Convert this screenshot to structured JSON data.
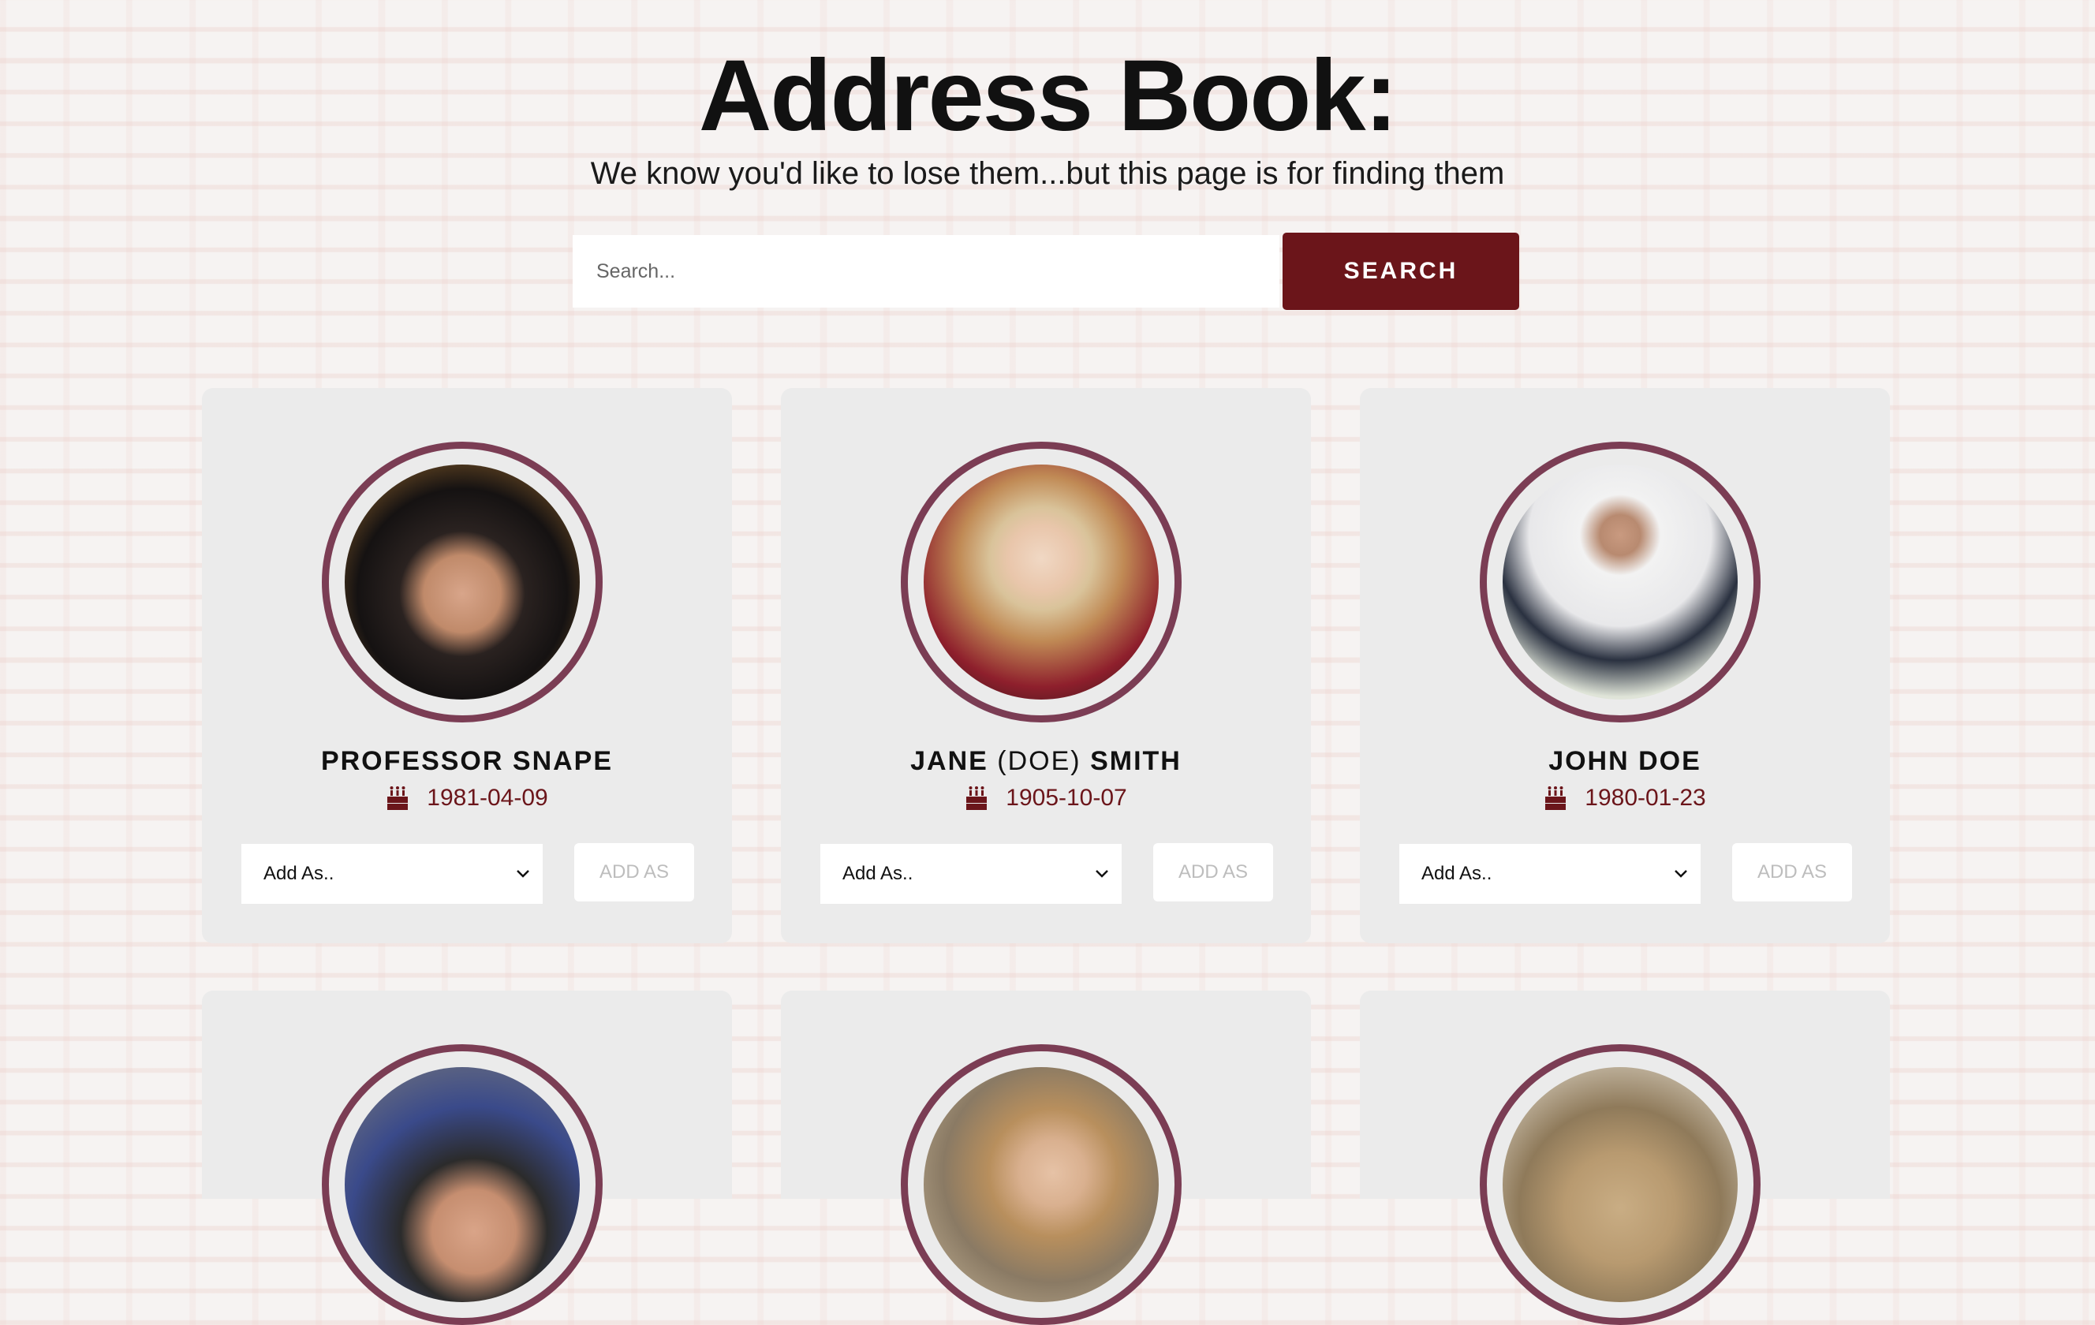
{
  "header": {
    "title": "Address Book:",
    "subtitle": "We know you'd like to lose them...but this page is for finding them"
  },
  "search": {
    "placeholder": "Search...",
    "button_label": "SEARCH"
  },
  "colors": {
    "accent": "#6b151a",
    "avatar_ring": "#7b3d54",
    "card_bg": "#ebebeb",
    "page_bg": "#f6f3f2"
  },
  "contacts": [
    {
      "first": "PROFESSOR",
      "maiden": "",
      "last": "SNAPE",
      "birthday": "1981-04-09",
      "select_value": "Add As..",
      "button_label": "ADD AS",
      "icon": "cake-icon"
    },
    {
      "first": "JANE",
      "maiden": "(DOE)",
      "last": "SMITH",
      "birthday": "1905-10-07",
      "select_value": "Add As..",
      "button_label": "ADD AS",
      "icon": "cake-icon"
    },
    {
      "first": "JOHN",
      "maiden": "",
      "last": "DOE",
      "birthday": "1980-01-23",
      "select_value": "Add As..",
      "button_label": "ADD AS",
      "icon": "cake-icon"
    }
  ]
}
